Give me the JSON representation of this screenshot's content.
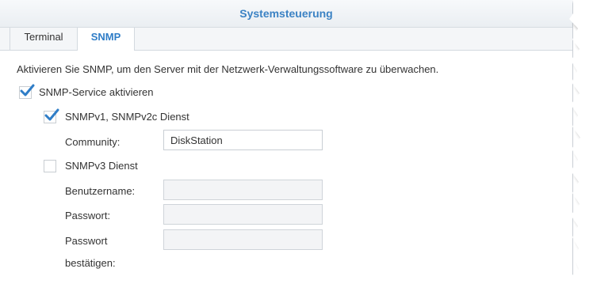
{
  "window": {
    "title": "Systemsteuerung"
  },
  "tabs": [
    {
      "label": "Terminal",
      "active": false
    },
    {
      "label": "SNMP",
      "active": true
    }
  ],
  "snmp": {
    "description": "Aktivieren Sie SNMP, um den Server mit der Netzwerk-Verwaltungssoftware zu überwachen.",
    "service_enable": {
      "label": "SNMP-Service aktivieren",
      "checked": true
    },
    "v1v2c": {
      "label": "SNMPv1, SNMPv2c Dienst",
      "checked": true,
      "community_label": "Community:",
      "community_value": "DiskStation"
    },
    "v3": {
      "label": "SNMPv3 Dienst",
      "checked": false,
      "username_label": "Benutzername:",
      "username_value": "",
      "password_label": "Passwort:",
      "password_value": "",
      "confirm_label_line1": "Passwort",
      "confirm_label_line2": "bestätigen:",
      "confirm_value": ""
    }
  },
  "colors": {
    "accent": "#3b82c4",
    "check": "#2f7dc7",
    "text": "#333333"
  }
}
